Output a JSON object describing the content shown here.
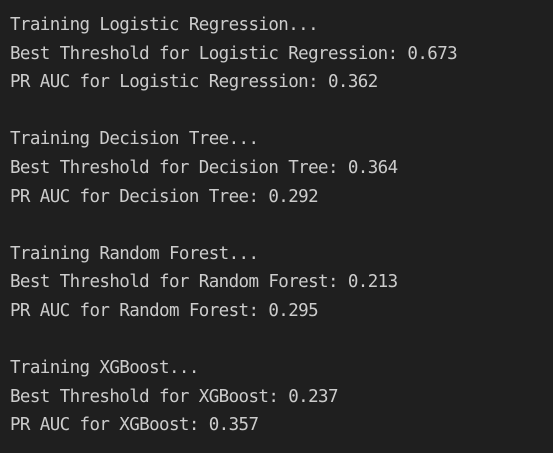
{
  "output_lines": [
    "Training Logistic Regression...",
    "Best Threshold for Logistic Regression: 0.673",
    "PR AUC for Logistic Regression: 0.362",
    "",
    "Training Decision Tree...",
    "Best Threshold for Decision Tree: 0.364",
    "PR AUC for Decision Tree: 0.292",
    "",
    "Training Random Forest...",
    "Best Threshold for Random Forest: 0.213",
    "PR AUC for Random Forest: 0.295",
    "",
    "Training XGBoost...",
    "Best Threshold for XGBoost: 0.237",
    "PR AUC for XGBoost: 0.357"
  ]
}
